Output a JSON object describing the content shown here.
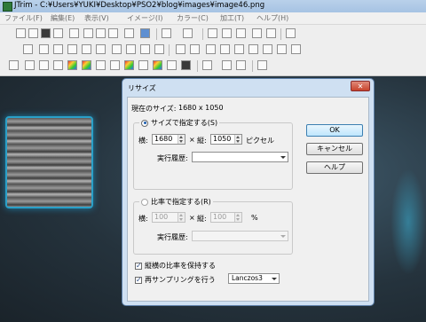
{
  "window": {
    "title": "JTrim - C:¥Users¥YUKI¥Desktop¥PSO2¥blog¥images¥image46.png"
  },
  "menu": [
    "ファイル(F)",
    "編集(E)",
    "表示(V)",
    "イメージ(I)",
    "カラー(C)",
    "加工(T)",
    "ヘルプ(H)"
  ],
  "dialog": {
    "title": "リサイズ",
    "close": "✕",
    "current_size_label": "現在のサイズ:",
    "current_size_value": "1680 x 1050",
    "size_group": {
      "radio_label": "サイズで指定する(S)",
      "selected": true,
      "width_label": "横:",
      "width_value": "1680",
      "times": "×",
      "height_label": "縦:",
      "height_value": "1050",
      "unit": "ピクセル",
      "history_label": "実行履歴:",
      "history_value": ""
    },
    "ratio_group": {
      "radio_label": "比率で指定する(R)",
      "selected": false,
      "width_label": "横:",
      "width_value": "100",
      "times": "×",
      "height_label": "縦:",
      "height_value": "100",
      "unit": "%",
      "history_label": "実行履歴:",
      "history_value": ""
    },
    "keep_ratio": {
      "label": "縦横の比率を保持する",
      "checked": true
    },
    "resample": {
      "label": "再サンプリングを行う",
      "checked": true,
      "method": "Lanczos3"
    },
    "buttons": {
      "ok": "OK",
      "cancel": "キャンセル",
      "help": "ヘルプ"
    }
  }
}
